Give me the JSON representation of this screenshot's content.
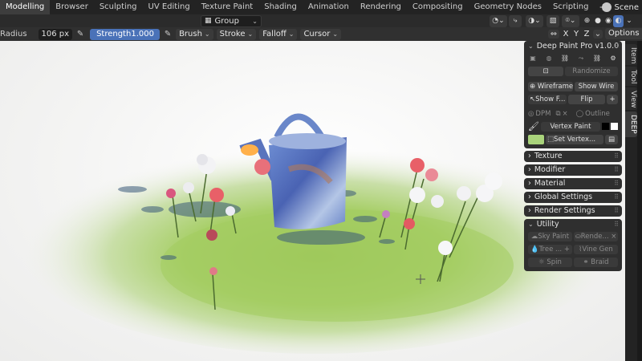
{
  "workspace_tabs": [
    "Modelling",
    "Browser",
    "Sculpting",
    "UV Editing",
    "Texture Paint",
    "Shading",
    "Animation",
    "Rendering",
    "Compositing",
    "Geometry Nodes",
    "Scripting"
  ],
  "active_tab": "Modelling",
  "add_tab": "+",
  "scene": {
    "label": "Scene"
  },
  "header": {
    "group_label": "Group",
    "options_label": "Options",
    "axis_x": "X",
    "axis_y": "Y",
    "axis_z": "Z"
  },
  "tool": {
    "radius_label": "Radius",
    "radius_value": "106 px",
    "strength_label": "Strength",
    "strength_value": "1.000",
    "brush": "Brush",
    "stroke": "Stroke",
    "falloff": "Falloff",
    "cursor": "Cursor"
  },
  "side_tabs": [
    "Item",
    "Tool",
    "View",
    "DEEP"
  ],
  "panel": {
    "title": "Deep Paint Pro v1.0.0",
    "randomize": "Randomize",
    "wireframe": "Wireframe",
    "show_wire": "Show Wire",
    "show_f": "Show F...",
    "flip": "Flip",
    "plus": "+",
    "dpm": "DPM",
    "outline": "Outline",
    "vertex_paint": "Vertex Paint",
    "set_vertex": "Set Vertex...",
    "sections": [
      "Texture",
      "Modifier",
      "Material",
      "Global Settings",
      "Render Settings"
    ],
    "utility": "Utility",
    "sky_paint": "Sky Paint",
    "render_short": "Rende...",
    "tree": "Tree ...",
    "vine_gen": "Vine Gen",
    "spin": "Spin",
    "braid": "Braid",
    "vertex_color": "#a9d37b"
  }
}
